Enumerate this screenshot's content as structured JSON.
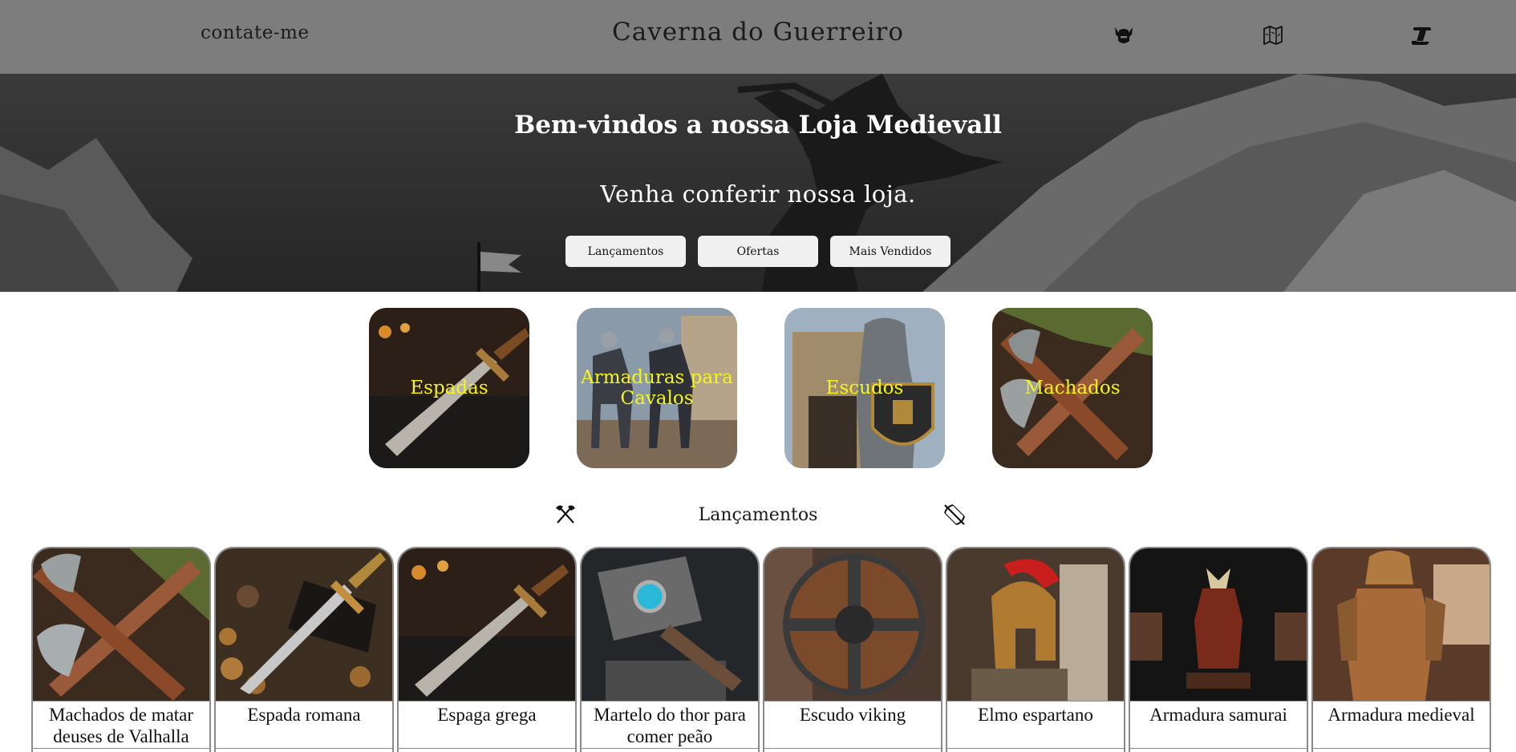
{
  "header": {
    "contact_label": "contate-me",
    "title": "Caverna do Guerreiro",
    "icons": [
      "viking-helmet-icon",
      "map-icon",
      "scroll-icon"
    ]
  },
  "hero": {
    "heading": "Bem-vindos a nossa Loja Medievall",
    "subheading": "Venha conferir nossa loja.",
    "buttons": [
      "Lançamentos",
      "Ofertas",
      "Mais Vendidos"
    ]
  },
  "categories": [
    {
      "label": "Espadas"
    },
    {
      "label": "Armaduras para Cavalos"
    },
    {
      "label": "Escudos"
    },
    {
      "label": "Machados"
    }
  ],
  "releases": {
    "title": "Lançamentos",
    "left_icon": "crossed-axes-icon",
    "right_icon": "crossbow-icon"
  },
  "products": [
    {
      "name": "Machados de matar deuses de Valhalla"
    },
    {
      "name": "Espada romana"
    },
    {
      "name": "Espaga grega"
    },
    {
      "name": "Martelo do thor para comer peão"
    },
    {
      "name": "Escudo viking"
    },
    {
      "name": "Elmo espartano"
    },
    {
      "name": "Armadura samurai"
    },
    {
      "name": "Armadura medieval"
    }
  ],
  "colors": {
    "header_bg": "#7d7d7d",
    "category_label": "#f5f51e",
    "button_bg": "#f0f0f0"
  }
}
